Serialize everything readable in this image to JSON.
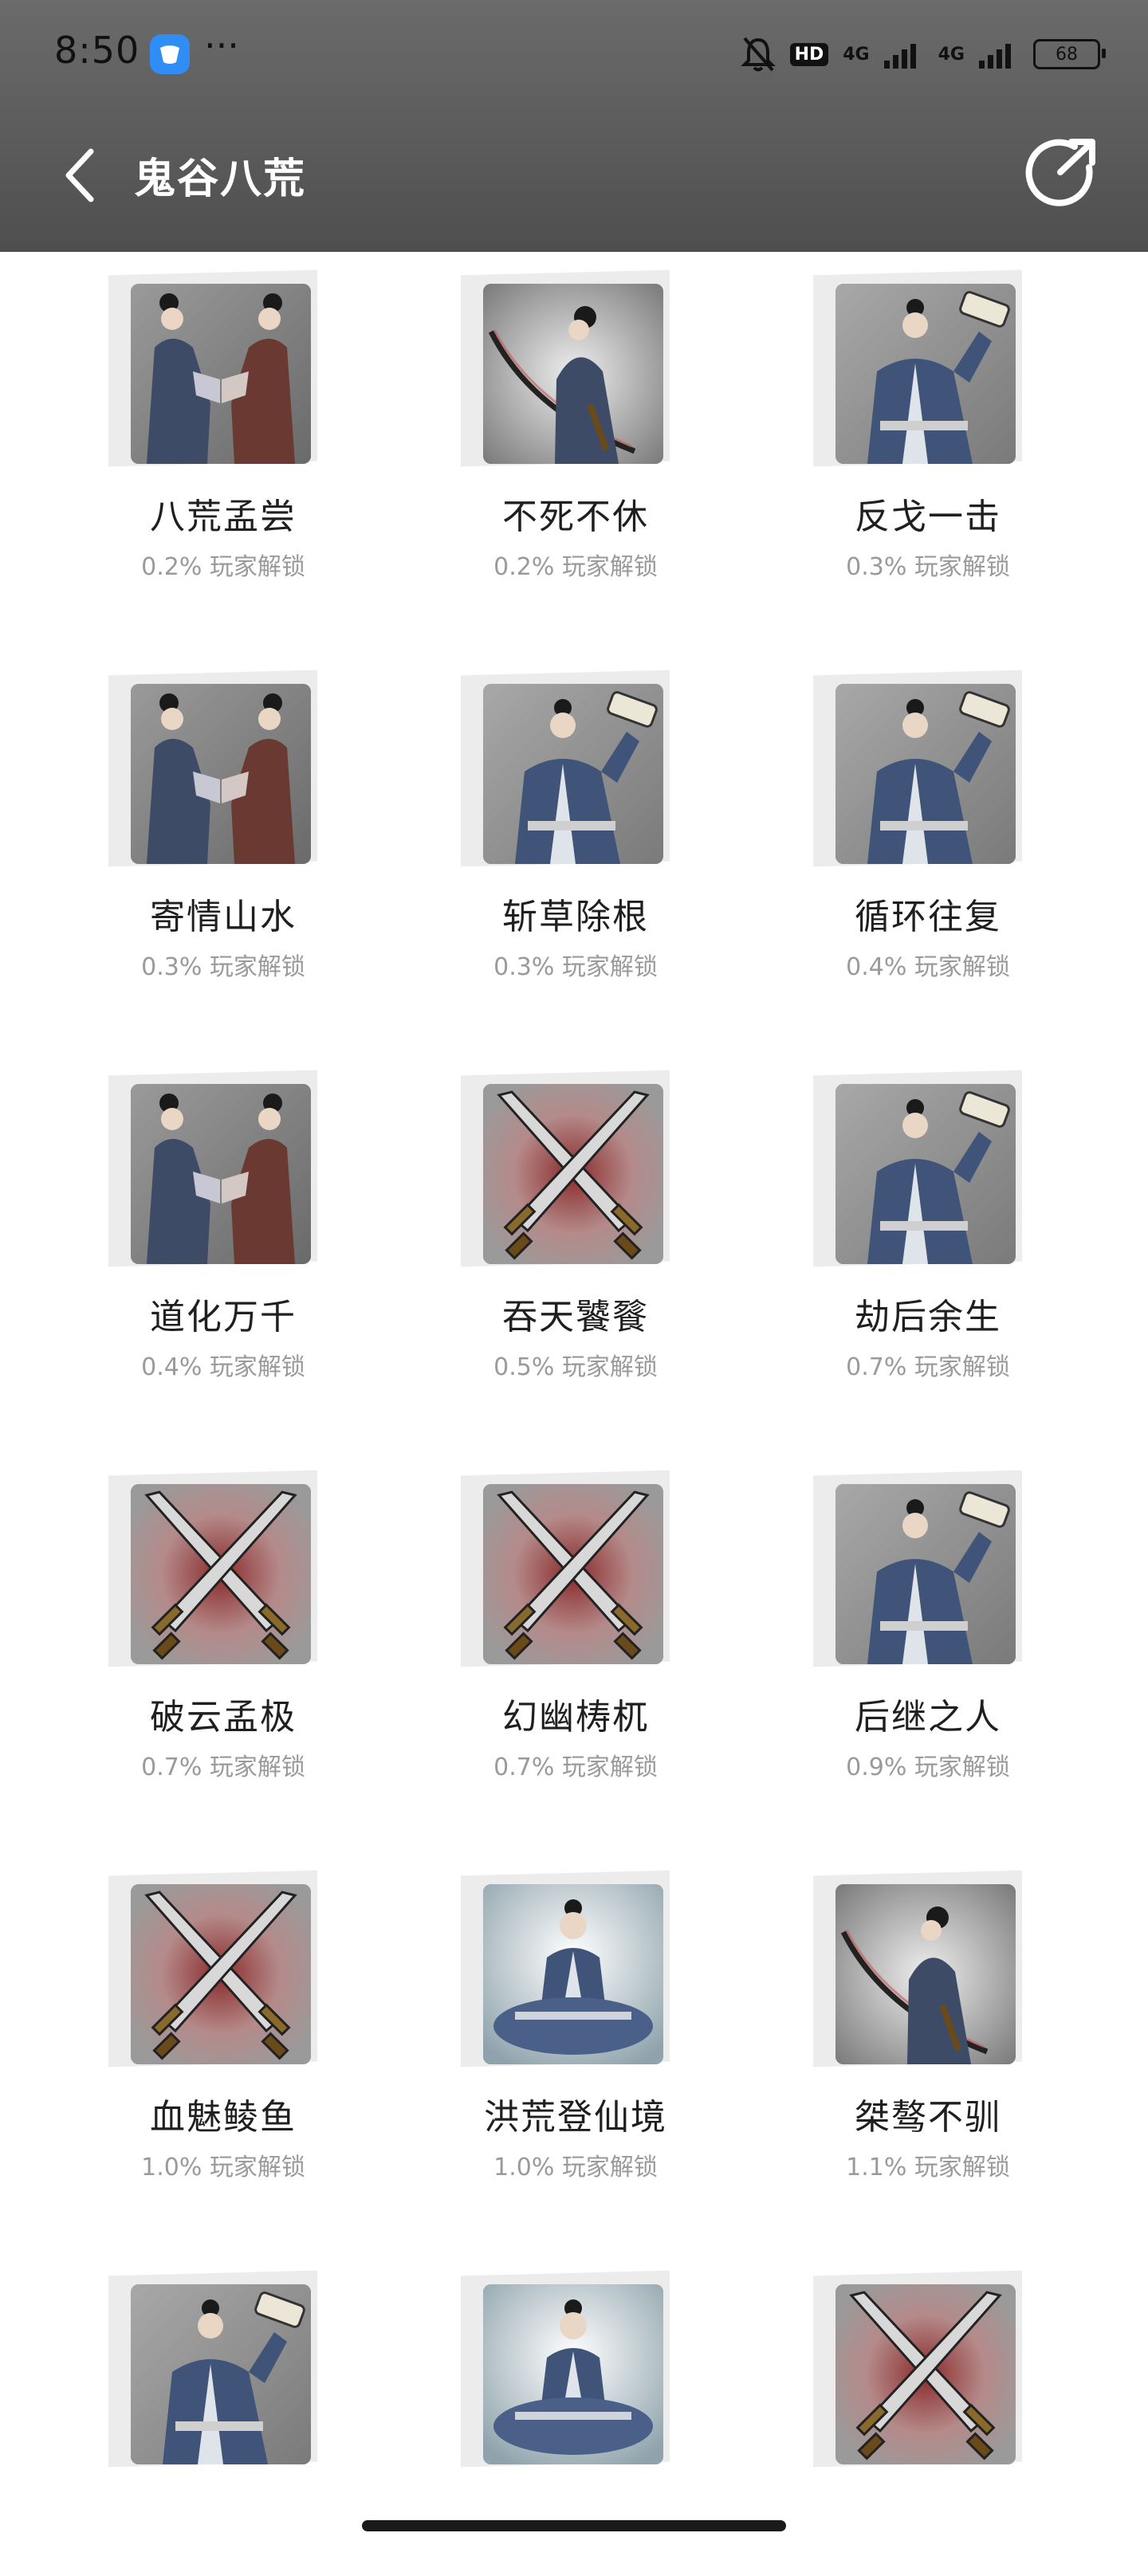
{
  "status": {
    "time": "8:50",
    "dots": "···",
    "hd": "HD",
    "net1": "4G",
    "net2": "4G",
    "battery": "68"
  },
  "header": {
    "title": "鬼谷八荒"
  },
  "achievements": [
    {
      "name": "八荒孟尝",
      "pct": "0.2% 玩家解锁",
      "icon": "two-scholars-icon"
    },
    {
      "name": "不死不休",
      "pct": "0.2% 玩家解锁",
      "icon": "swordsman-icon"
    },
    {
      "name": "反戈一击",
      "pct": "0.3% 玩家解锁",
      "icon": "scroll-scholar-icon"
    },
    {
      "name": "寄情山水",
      "pct": "0.3% 玩家解锁",
      "icon": "two-scholars-icon"
    },
    {
      "name": "斩草除根",
      "pct": "0.3% 玩家解锁",
      "icon": "scroll-scholar-icon"
    },
    {
      "name": "循环往复",
      "pct": "0.4% 玩家解锁",
      "icon": "scroll-scholar-icon"
    },
    {
      "name": "道化万千",
      "pct": "0.4% 玩家解锁",
      "icon": "two-scholars-icon"
    },
    {
      "name": "吞天饕餮",
      "pct": "0.5% 玩家解锁",
      "icon": "crossed-swords-icon"
    },
    {
      "name": "劫后余生",
      "pct": "0.7% 玩家解锁",
      "icon": "scroll-scholar-icon"
    },
    {
      "name": "破云孟极",
      "pct": "0.7% 玩家解锁",
      "icon": "crossed-swords-icon"
    },
    {
      "name": "幻幽梼杌",
      "pct": "0.7% 玩家解锁",
      "icon": "crossed-swords-icon"
    },
    {
      "name": "后继之人",
      "pct": "0.9% 玩家解锁",
      "icon": "scroll-scholar-icon"
    },
    {
      "name": "血魅鲮鱼",
      "pct": "1.0% 玩家解锁",
      "icon": "crossed-swords-icon"
    },
    {
      "name": "洪荒登仙境",
      "pct": "1.0% 玩家解锁",
      "icon": "meditating-sage-icon"
    },
    {
      "name": "桀骜不驯",
      "pct": "1.1% 玩家解锁",
      "icon": "swordsman-icon"
    },
    {
      "name": "",
      "pct": "",
      "icon": "scroll-scholar-icon"
    },
    {
      "name": "",
      "pct": "",
      "icon": "meditating-sage-icon"
    },
    {
      "name": "",
      "pct": "",
      "icon": "crossed-swords-icon"
    }
  ]
}
